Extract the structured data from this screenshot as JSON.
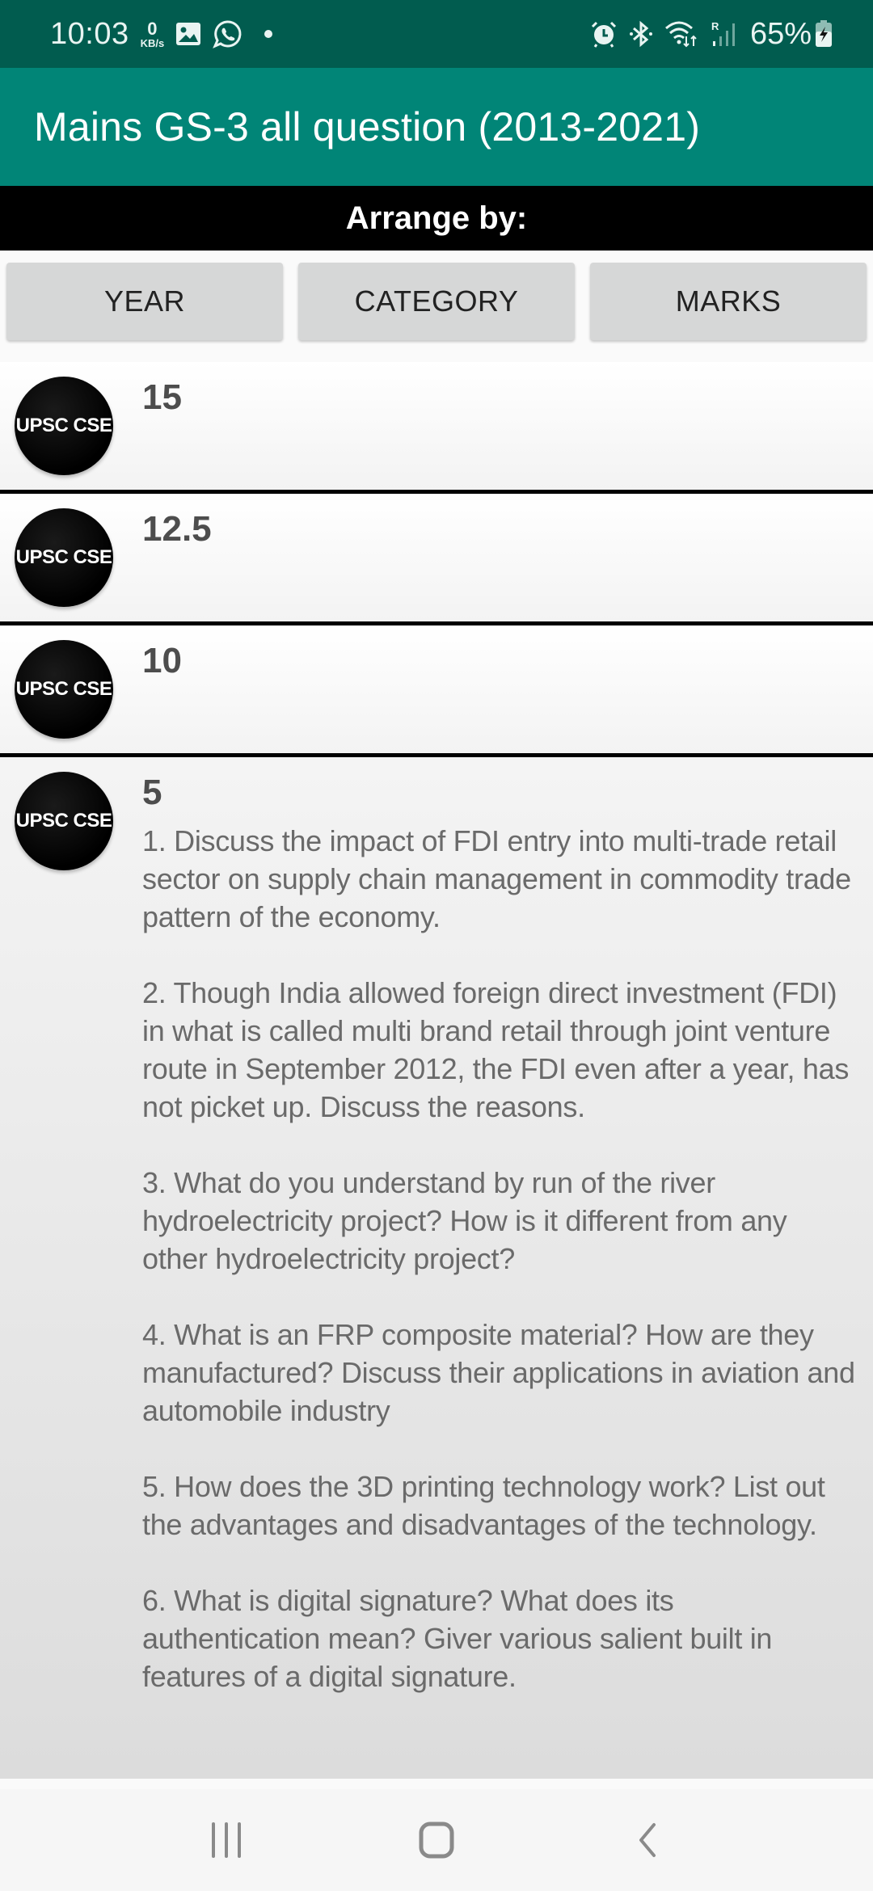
{
  "status_bar": {
    "time": "10:03",
    "net_speed_value": "0",
    "net_speed_unit": "KB/s",
    "left_icons": [
      "gallery-icon",
      "whatsapp-icon",
      "notification-dot"
    ],
    "right_icons": [
      "alarm-icon",
      "bluetooth-icon",
      "wifi-icon",
      "signal-roaming-icon"
    ],
    "roaming_label": "R",
    "battery_percent": "65%",
    "battery_charging": true
  },
  "app_bar": {
    "title": "Mains GS-3 all question (2013-2021)",
    "color": "#018577"
  },
  "arrange": {
    "label": "Arrange by:",
    "buttons": [
      {
        "label": "YEAR"
      },
      {
        "label": "CATEGORY"
      },
      {
        "label": "MARKS"
      }
    ]
  },
  "list": {
    "avatar_label": "UPSC CSE",
    "groups": [
      {
        "marks": "15",
        "questions": []
      },
      {
        "marks": "12.5",
        "questions": []
      },
      {
        "marks": "10",
        "questions": []
      },
      {
        "marks": "5",
        "questions": [
          "1. Discuss the impact of FDI entry into multi-trade retail sector on supply chain management in commodity trade pattern of the economy.",
          "2. Though India allowed foreign direct investment (FDI) in what is called multi brand retail through joint venture route in September 2012, the FDI even after a year, has not picket up. Discuss the reasons.",
          "3. What do you understand by run of the river hydroelectricity project? How is it different from any other hydroelectricity project?",
          "4. What is an FRP composite material? How are they manufactured? Discuss their applications in aviation and automobile industry",
          "5. How does the 3D printing technology work? List out the advantages and disadvantages of the technology.",
          "6. What is digital signature? What does its authentication mean? Giver various salient built in features of a digital signature."
        ]
      }
    ]
  },
  "nav_bar": {
    "buttons": [
      "recent-apps",
      "home",
      "back"
    ]
  }
}
